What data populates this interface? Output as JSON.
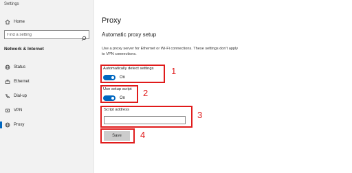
{
  "app": {
    "title": "Settings"
  },
  "sidebar": {
    "home_label": "Home",
    "search_placeholder": "Find a setting",
    "section": "Network & Internet",
    "items": [
      {
        "label": "Status",
        "icon": "globe-icon"
      },
      {
        "label": "Ethernet",
        "icon": "ethernet-icon"
      },
      {
        "label": "Dial-up",
        "icon": "phone-icon"
      },
      {
        "label": "VPN",
        "icon": "vpn-icon"
      },
      {
        "label": "Proxy",
        "icon": "globe-icon",
        "active": true
      }
    ]
  },
  "main": {
    "title": "Proxy",
    "subtitle": "Automatic proxy setup",
    "description": "Use a proxy server for Ethernet or Wi-Fi connections. These settings don't apply to VPN connections.",
    "auto_detect": {
      "label": "Automatically detect settings",
      "state": "On"
    },
    "setup_script": {
      "label": "Use setup script",
      "state": "On"
    },
    "script_address": {
      "label": "Script address",
      "value": ""
    },
    "save_label": "Save"
  },
  "annotations": [
    "1",
    "2",
    "3",
    "4"
  ],
  "colors": {
    "accent": "#0067c0",
    "annotation": "#e01b1b",
    "sidebar_bg": "#f2f2f2"
  }
}
